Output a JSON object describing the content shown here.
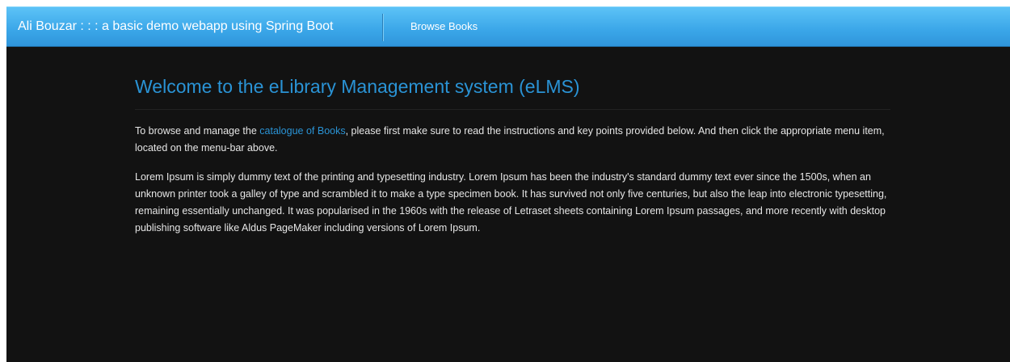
{
  "navbar": {
    "brand": "Ali Bouzar : : : a basic demo webapp using Spring Boot",
    "menu_item": "Browse Books",
    "color": "#3aa6e8"
  },
  "main": {
    "title": "Welcome to the eLibrary Management system (eLMS)",
    "intro": {
      "before": "To browse and manage the ",
      "link": "catalogue of Books",
      "after": ", please first make sure to read the instructions and key points provided below. And then click the appropriate menu item, located on the menu-bar above."
    },
    "lorem": "Lorem Ipsum is simply dummy text of the printing and typesetting industry. Lorem Ipsum has been the industry's standard dummy text ever since the 1500s, when an unknown printer took a galley of type and scrambled it to make a type specimen book. It has survived not only five centuries, but also the leap into electronic typesetting, remaining essentially unchanged. It was popularised in the 1960s with the release of Letraset sheets containing Lorem Ipsum passages, and more recently with desktop publishing software like Aldus PageMaker including versions of Lorem Ipsum."
  },
  "colors": {
    "background": "#121212",
    "accent": "#2a93d5",
    "text": "#e6e6e6"
  }
}
